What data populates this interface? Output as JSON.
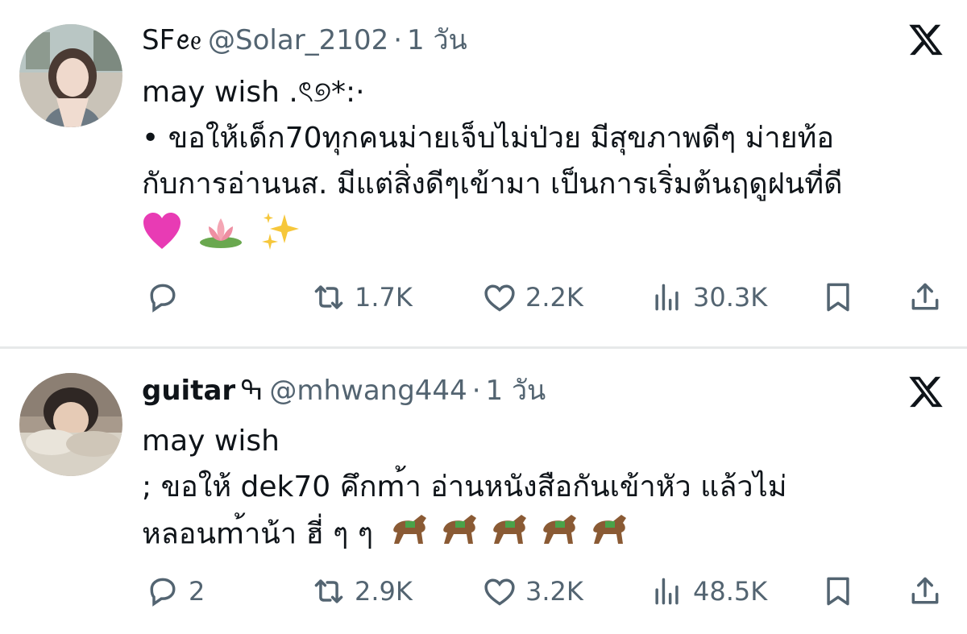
{
  "tweets": [
    {
      "display_name": "SFꫀᧉ",
      "handle": "@Solar_2102",
      "dot": "·",
      "time": "1 วัน",
      "lines": [
        "may wish .ৎ୭*:·",
        "• ขอให้เด็ก70ทุกคนม่ายเจ็บไม่ป่วย มีสุขภาพดีๆ ม่ายท้อ",
        "กับการอ่านนส. มีแต่สิ่งดีๆเข้ามา เป็นการเริ่มต้นฤดูฝนที่ดี"
      ],
      "emoji_line": [
        "pink-heart",
        "lotus",
        "sparkles"
      ],
      "stats": {
        "reply": "",
        "retweet": "1.7K",
        "like": "2.2K",
        "views": "30.3K"
      }
    },
    {
      "display_name": "guitar",
      "name_emoji": "ߒ",
      "handle": "@mhwang444",
      "dot": "·",
      "time": "1 วัน",
      "lines": [
        "may wish",
        "; ขอให้ dek70 คึกm้า อ่านหนังสือกันเข้าหัว แล้วไม่",
        "หลอนm้าน้า ฮี่ ๆ ๆ"
      ],
      "emoji_line": [
        "horse-racing",
        "horse-racing",
        "horse-racing",
        "horse-racing",
        "horse-racing"
      ],
      "stats": {
        "reply": "2",
        "retweet": "2.9K",
        "like": "3.2K",
        "views": "48.5K"
      }
    }
  ],
  "colors": {
    "text": "#0f1419",
    "muted": "#536471",
    "divider": "#e7e9ea"
  }
}
